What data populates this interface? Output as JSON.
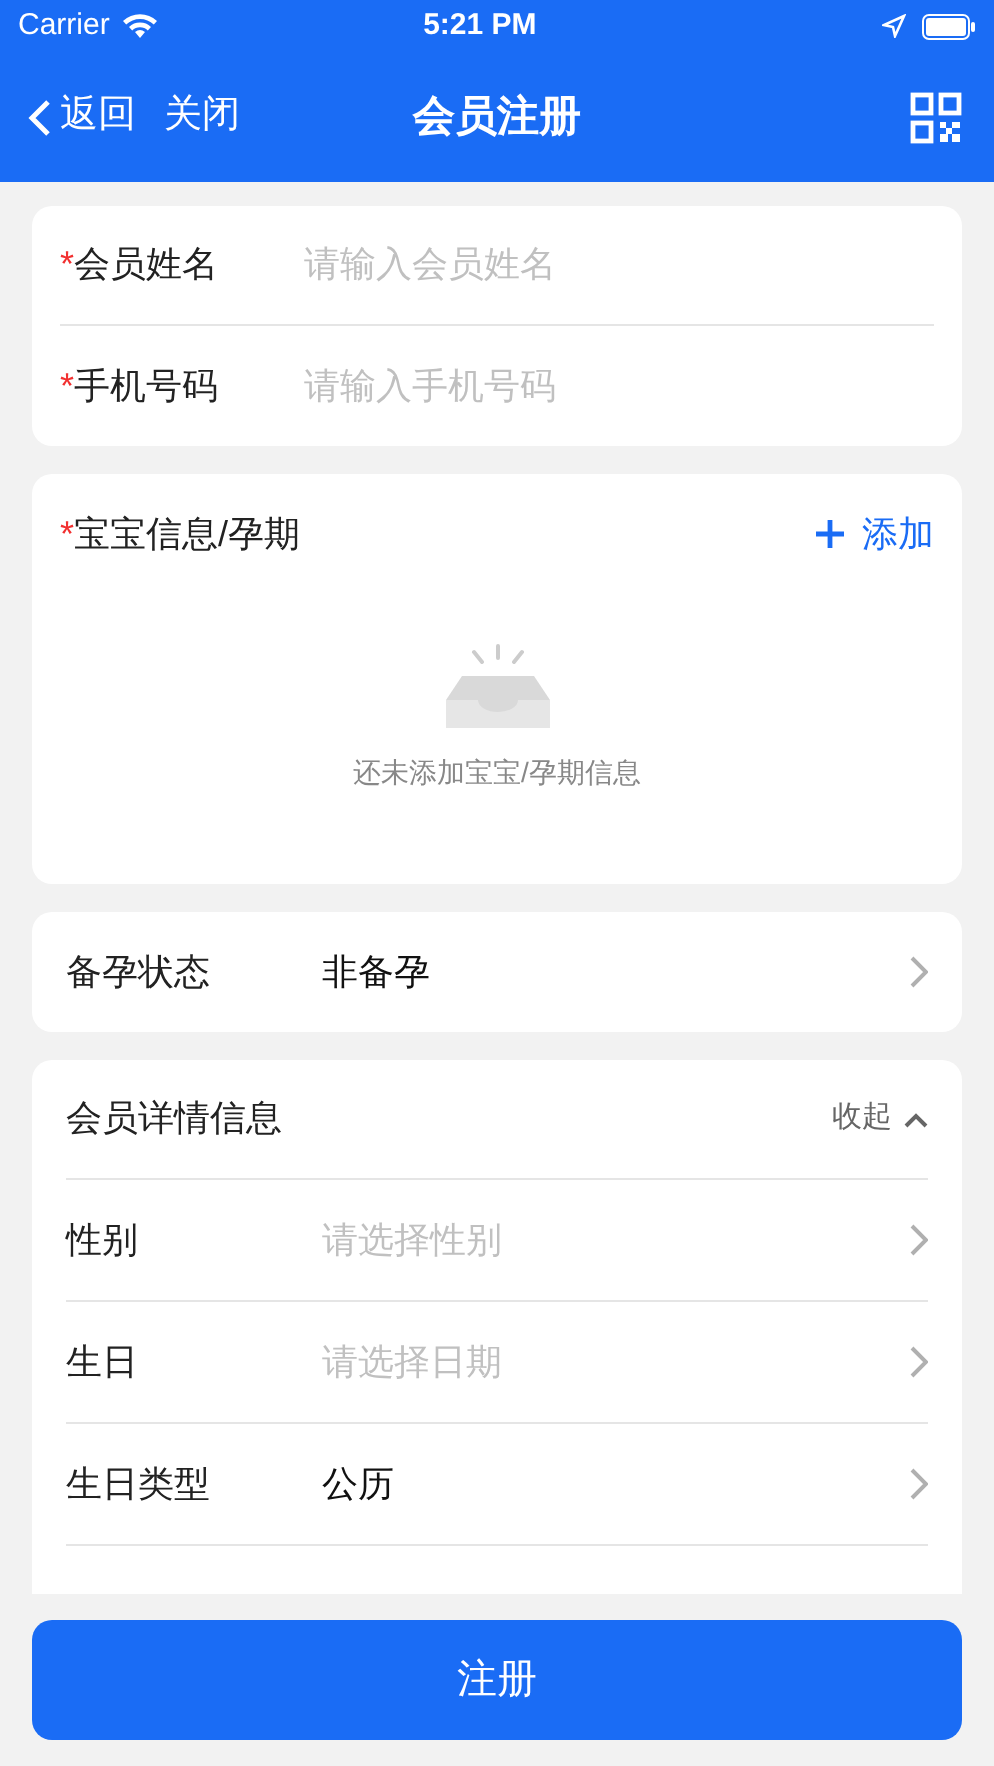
{
  "status_bar": {
    "carrier": "Carrier",
    "time": "5:21 PM"
  },
  "nav": {
    "back": "返回",
    "close": "关闭",
    "title": "会员注册"
  },
  "basic_fields": [
    {
      "label": "会员姓名",
      "placeholder": "请输入会员姓名",
      "required": true
    },
    {
      "label": "手机号码",
      "placeholder": "请输入手机号码",
      "required": true
    }
  ],
  "baby": {
    "label": "宝宝信息/孕期",
    "required": true,
    "add": "添加",
    "empty": "还未添加宝宝/孕期信息"
  },
  "pregnancy_status": {
    "label": "备孕状态",
    "value": "非备孕"
  },
  "details": {
    "title": "会员详情信息",
    "toggle": "收起",
    "expanded": true,
    "rows": [
      {
        "label": "性别",
        "placeholder": "请选择性别"
      },
      {
        "label": "生日",
        "placeholder": "请选择日期"
      },
      {
        "label": "生日类型",
        "value": "公历"
      }
    ]
  },
  "submit": "注册",
  "required_mark": "*"
}
